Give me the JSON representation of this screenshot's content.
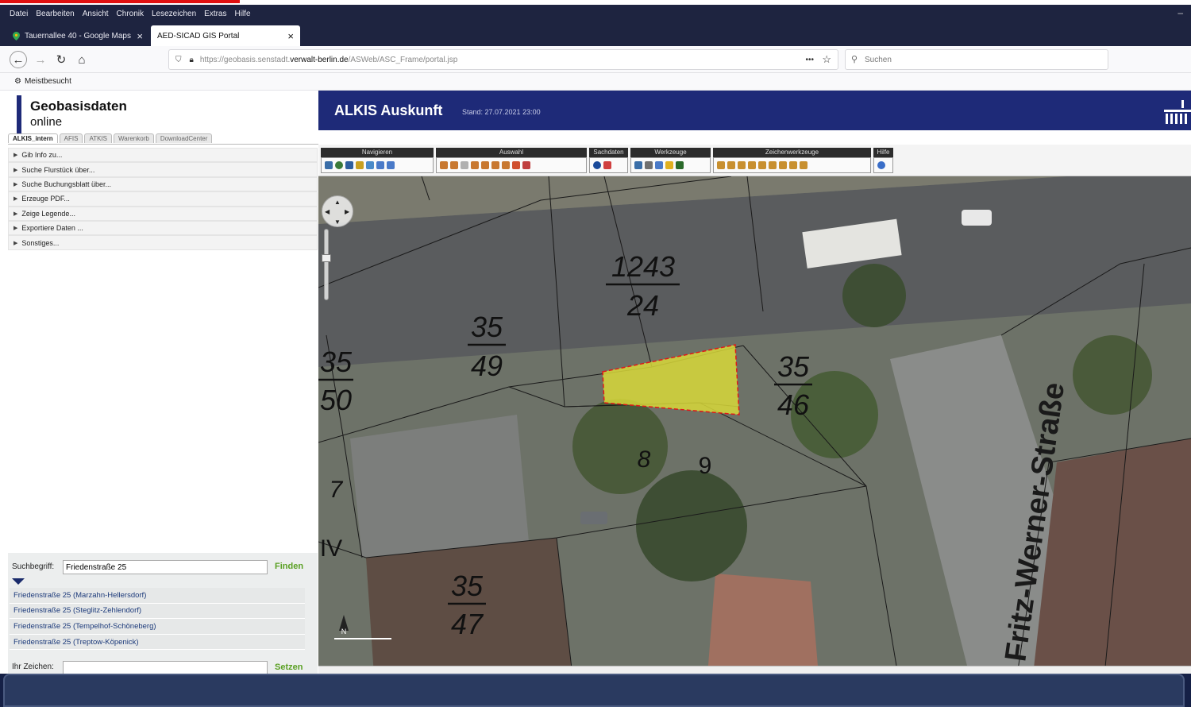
{
  "browser": {
    "menu": [
      "Datei",
      "Bearbeiten",
      "Ansicht",
      "Chronik",
      "Lesezeichen",
      "Extras",
      "Hilfe"
    ],
    "tabs": [
      {
        "label": "Tauernallee 40 - Google Maps"
      },
      {
        "label": "AED-SICAD GIS Portal"
      }
    ],
    "url_prefix": "https://geobasis.senstadt.",
    "url_host": "verwalt-berlin.de",
    "url_path": "/ASWeb/ASC_Frame/portal.jsp",
    "url_more": "•••",
    "search_placeholder": "Suchen",
    "bookmark": "Meistbesucht"
  },
  "panel": {
    "title": "Geobasisdaten",
    "subtitle": "online",
    "tabs": [
      "ALKIS_intern",
      "AFIS",
      "ATKIS",
      "Warenkorb",
      "DownloadCenter"
    ],
    "menu": [
      "Gib Info zu...",
      "Suche Flurstück über...",
      "Suche Buchungsblatt über...",
      "Erzeuge PDF...",
      "Zeige Legende...",
      "Exportiere Daten ...",
      "Sonstiges..."
    ],
    "search_label": "Suchbegriff:",
    "search_value": "Friedenstraße 25",
    "find_label": "Finden",
    "results": [
      "Friedenstraße 25 (Marzahn-Hellersdorf)",
      "Friedenstraße 25 (Steglitz-Zehlendorf)",
      "Friedenstraße 25 (Tempelhof-Schöneberg)",
      "Friedenstraße 25 (Treptow-Köpenick)"
    ],
    "sign_label": "Ihr Zeichen:",
    "set_label": "Setzen"
  },
  "header": {
    "title": "ALKIS Auskunft",
    "stand": "Stand: 27.07.2021 23:00"
  },
  "toolbar": {
    "groups": [
      "Navigieren",
      "Auswahl",
      "Sachdaten",
      "Werkzeuge",
      "Zeichenwerkzeuge",
      "Hilfe"
    ]
  },
  "map": {
    "parcel_labels": [
      {
        "num": "1243",
        "den": "24"
      },
      {
        "num": "35",
        "den": "49"
      },
      {
        "num": "35",
        "den": "50"
      },
      {
        "num": "35",
        "den": "46"
      },
      {
        "num": "35",
        "den": "47"
      }
    ],
    "house_numbers": [
      "8",
      "9",
      "7"
    ],
    "roman": "IV",
    "street": "Fritz-Werner-Straße",
    "north_label": "N",
    "colors": {
      "selection_fill": "#d8d83a",
      "selection_stroke": "#e01818",
      "header": "#1e2a78"
    }
  }
}
